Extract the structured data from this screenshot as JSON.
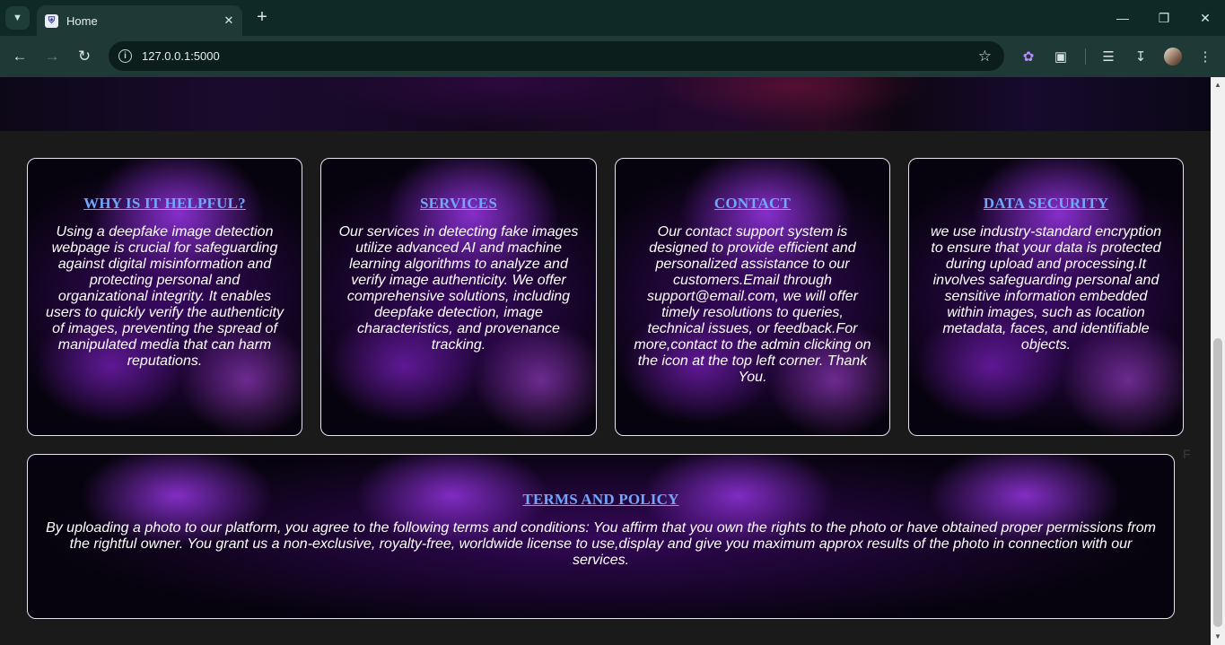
{
  "browser": {
    "tab_title": "Home",
    "url": "127.0.0.1:5000",
    "icons": {
      "tab_search": "chevron-down-icon",
      "favicon": "shield-icon",
      "tab_close": "close-icon",
      "new_tab": "plus-icon",
      "minimize": "minimize-icon",
      "restore": "restore-icon",
      "close_window": "close-icon",
      "back": "arrow-left-icon",
      "forward": "arrow-right-icon",
      "reload": "reload-icon",
      "site_info": "info-icon",
      "bookmark": "star-icon",
      "extension_ai": "brain-icon",
      "extensions": "puzzle-icon",
      "media": "media-control-icon",
      "downloads": "download-icon",
      "profile": "avatar",
      "menu": "kebab-menu-icon"
    }
  },
  "sections": [
    {
      "title": "WHY IS IT HELPFUL?",
      "body": "Using a deepfake image detection webpage is crucial for safeguarding against digital misinformation and protecting personal and organizational integrity. It enables users to quickly verify the authenticity of images, preventing the spread of manipulated media that can harm reputations."
    },
    {
      "title": "SERVICES",
      "body": "Our services in detecting fake images utilize advanced AI and machine learning algorithms to analyze and verify image authenticity. We offer comprehensive solutions, including deepfake detection, image characteristics, and provenance tracking."
    },
    {
      "title": "CONTACT",
      "body": "Our contact support system is designed to provide efficient and personalized assistance to our customers.Email through support@email.com, we will offer timely resolutions to queries, technical issues, or feedback.For more,contact to the admin clicking on the icon at the top left corner. Thank You."
    },
    {
      "title": "DATA SECURITY",
      "body": "we use industry-standard encryption to ensure that your data is protected during upload and processing.It involves safeguarding personal and sensitive information embedded within images, such as location metadata, faces, and identifiable objects."
    }
  ],
  "terms": {
    "title": "TERMS AND POLICY",
    "body": "By uploading a photo to our platform, you agree to the following terms and conditions: You affirm that you own the rights to the photo or have obtained proper permissions from the rightful owner. You grant us a non-exclusive, royalty-free, worldwide license to use,display and give you maximum approx results of the photo in connection with our services."
  },
  "stray_text": "F",
  "colors": {
    "heading_link": "#6fa6ff",
    "card_border": "#e7e2ee",
    "page_bg": "#1a1a1a",
    "chrome_bg": "#1f3a36"
  }
}
